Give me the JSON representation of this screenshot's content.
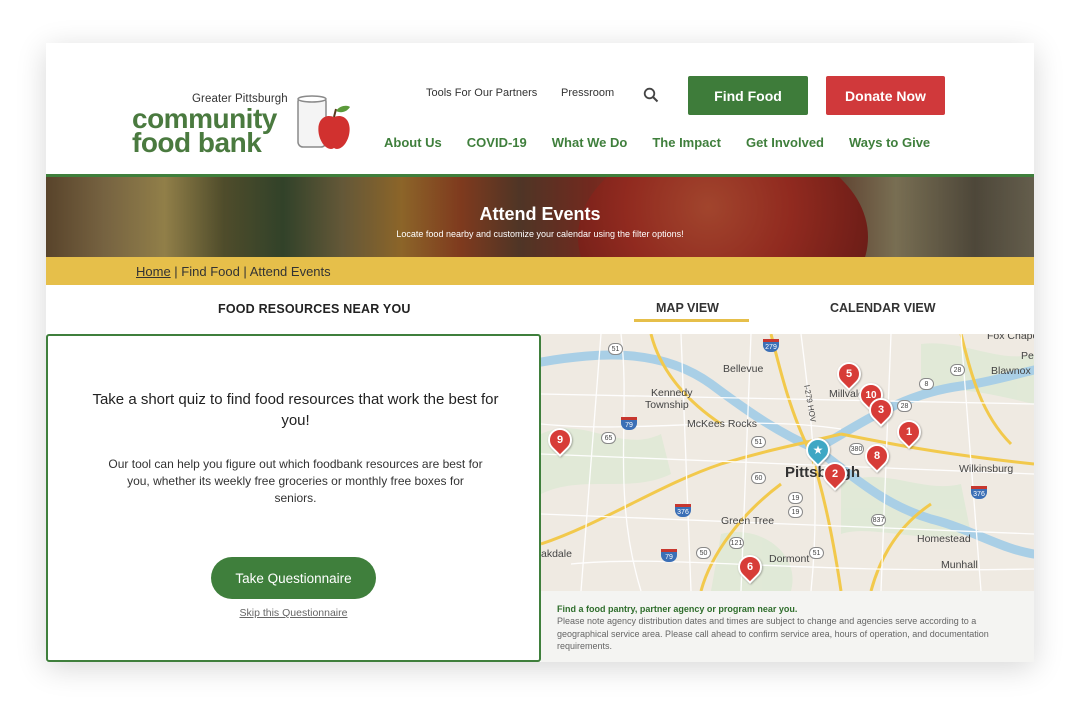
{
  "logo": {
    "small": "Greater Pittsburgh",
    "line1": "community",
    "line2": "food bank"
  },
  "toplinks": [
    "Tools For Our Partners",
    "Pressroom"
  ],
  "buttons": {
    "find": "Find Food",
    "donate": "Donate Now"
  },
  "nav": [
    "About Us",
    "COVID-19",
    "What We Do",
    "The Impact",
    "Get Involved",
    "Ways to Give"
  ],
  "hero": {
    "title": "Attend Events",
    "subtitle": "Locate food nearby and customize your calendar using the filter options!"
  },
  "breadcrumb": {
    "home": "Home",
    "rest": " | Find Food | Attend Events"
  },
  "resources": {
    "title": "FOOD RESOURCES NEAR YOU"
  },
  "tabs": {
    "map": "MAP VIEW",
    "calendar": "CALENDAR VIEW"
  },
  "quiz": {
    "title": "Take a short quiz to find food resources that work the best for you!",
    "body": "Our tool can help you figure out which foodbank resources are best for you, whether its weekly free groceries or monthly free boxes for seniors.",
    "button": "Take Questionnaire",
    "skip": "Skip this Questionnaire"
  },
  "map": {
    "places": {
      "bellevue": "Bellevue",
      "kennedy": "Kennedy",
      "township": "Township",
      "mckees": "McKees Rocks",
      "millvale": "Millvale",
      "pittsburgh": "Pittsburgh",
      "green_tree": "Green Tree",
      "dormont": "Dormont",
      "oakdale": "akdale",
      "homestead": "Homestead",
      "munhall": "Munhall",
      "wilkinsburg": "Wilkinsburg",
      "blawnox": "Blawnox",
      "fox_chapel": "Fox Chapel",
      "pe": "Pe",
      "hov": "I-279 HOV"
    },
    "routes": [
      "51",
      "279",
      "28",
      "79",
      "51",
      "380",
      "376",
      "60",
      "19",
      "837",
      "121",
      "50",
      "79",
      "51",
      "8",
      "376",
      "19",
      "28",
      "65"
    ],
    "pins": [
      "5",
      "10",
      "3",
      "1",
      "8",
      "9",
      "2",
      "6"
    ],
    "note_title": "Find a food pantry, partner agency or program near you.",
    "note_body": "Please note agency distribution dates and times are subject to change and agencies serve according to a geographical service area. Please call ahead to confirm service area, hours of operation, and documentation requirements."
  },
  "colors": {
    "green": "#3f7f3c",
    "red": "#d0393b",
    "gold": "#e6bf4a"
  }
}
